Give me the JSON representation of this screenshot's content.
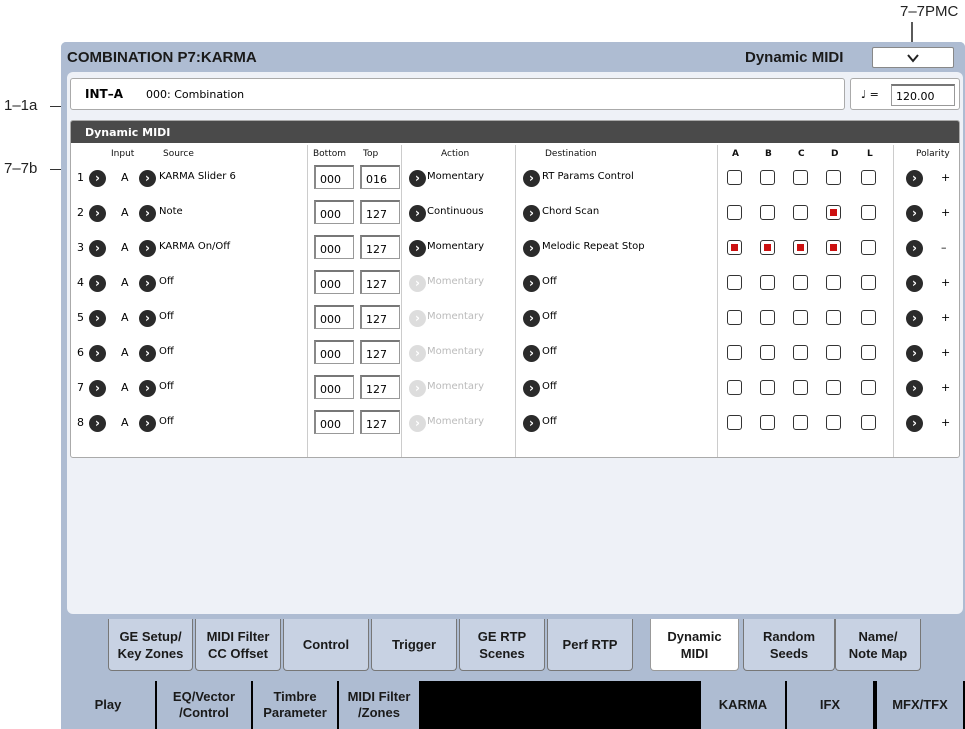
{
  "annotations": {
    "pmc": "7–7PMC",
    "info": "1–1a",
    "dm": "7–7b"
  },
  "title": "COMBINATION P7:KARMA",
  "page_menu": "Dynamic MIDI",
  "info": {
    "bank": "INT–A",
    "combination": "000: Combination",
    "tempo_label": "♩ =",
    "tempo": "120.00"
  },
  "panel_title": "Dynamic MIDI",
  "columns": {
    "input": "Input",
    "source": "Source",
    "bottom": "Bottom",
    "top": "Top",
    "action": "Action",
    "destination": "Destination",
    "a": "A",
    "b": "B",
    "c": "C",
    "d": "D",
    "l": "L",
    "polarity": "Polarity"
  },
  "rows": [
    {
      "num": "1",
      "input": "A",
      "source": "KARMA Slider 6",
      "bottom": "000",
      "top": "016",
      "action": "Momentary",
      "action_enabled": true,
      "destination": "RT Params Control",
      "checks": [
        false,
        false,
        false,
        false,
        false
      ],
      "polarity": "+"
    },
    {
      "num": "2",
      "input": "A",
      "source": "Note",
      "bottom": "000",
      "top": "127",
      "action": "Continuous",
      "action_enabled": true,
      "destination": "Chord Scan",
      "checks": [
        false,
        false,
        false,
        true,
        false
      ],
      "polarity": "+"
    },
    {
      "num": "3",
      "input": "A",
      "source": "KARMA On/Off",
      "bottom": "000",
      "top": "127",
      "action": "Momentary",
      "action_enabled": true,
      "destination": "Melodic Repeat Stop",
      "checks": [
        true,
        true,
        true,
        true,
        false
      ],
      "polarity": "–"
    },
    {
      "num": "4",
      "input": "A",
      "source": "Off",
      "bottom": "000",
      "top": "127",
      "action": "Momentary",
      "action_enabled": false,
      "destination": "Off",
      "checks": [
        false,
        false,
        false,
        false,
        false
      ],
      "polarity": "+"
    },
    {
      "num": "5",
      "input": "A",
      "source": "Off",
      "bottom": "000",
      "top": "127",
      "action": "Momentary",
      "action_enabled": false,
      "destination": "Off",
      "checks": [
        false,
        false,
        false,
        false,
        false
      ],
      "polarity": "+"
    },
    {
      "num": "6",
      "input": "A",
      "source": "Off",
      "bottom": "000",
      "top": "127",
      "action": "Momentary",
      "action_enabled": false,
      "destination": "Off",
      "checks": [
        false,
        false,
        false,
        false,
        false
      ],
      "polarity": "+"
    },
    {
      "num": "7",
      "input": "A",
      "source": "Off",
      "bottom": "000",
      "top": "127",
      "action": "Momentary",
      "action_enabled": false,
      "destination": "Off",
      "checks": [
        false,
        false,
        false,
        false,
        false
      ],
      "polarity": "+"
    },
    {
      "num": "8",
      "input": "A",
      "source": "Off",
      "bottom": "000",
      "top": "127",
      "action": "Momentary",
      "action_enabled": false,
      "destination": "Off",
      "checks": [
        false,
        false,
        false,
        false,
        false
      ],
      "polarity": "+"
    }
  ],
  "tabs": [
    {
      "l1": "GE Setup/",
      "l2": "Key Zones",
      "selected": false
    },
    {
      "l1": "MIDI Filter",
      "l2": "CC Offset",
      "selected": false
    },
    {
      "l1": "Control",
      "l2": "",
      "selected": false
    },
    {
      "l1": "Trigger",
      "l2": "",
      "selected": false
    },
    {
      "l1": "GE RTP",
      "l2": "Scenes",
      "selected": false
    },
    {
      "l1": "Perf RTP",
      "l2": "",
      "selected": false
    },
    {
      "l1": "Dynamic",
      "l2": "MIDI",
      "selected": true
    },
    {
      "l1": "Random",
      "l2": "Seeds",
      "selected": false
    },
    {
      "l1": "Name/",
      "l2": "Note Map",
      "selected": false
    }
  ],
  "modes": [
    {
      "l1": "Play",
      "l2": ""
    },
    {
      "l1": "EQ/Vector",
      "l2": "/Control"
    },
    {
      "l1": "Timbre",
      "l2": "Parameter"
    },
    {
      "l1": "MIDI Filter",
      "l2": "/Zones"
    },
    {
      "l1": "KARMA",
      "l2": ""
    },
    {
      "l1": "IFX",
      "l2": ""
    },
    {
      "l1": "MFX/TFX",
      "l2": ""
    }
  ],
  "colors": {
    "frame": "#aebcd2",
    "header": "#4a4a4a",
    "check_on": "#cc1111"
  }
}
